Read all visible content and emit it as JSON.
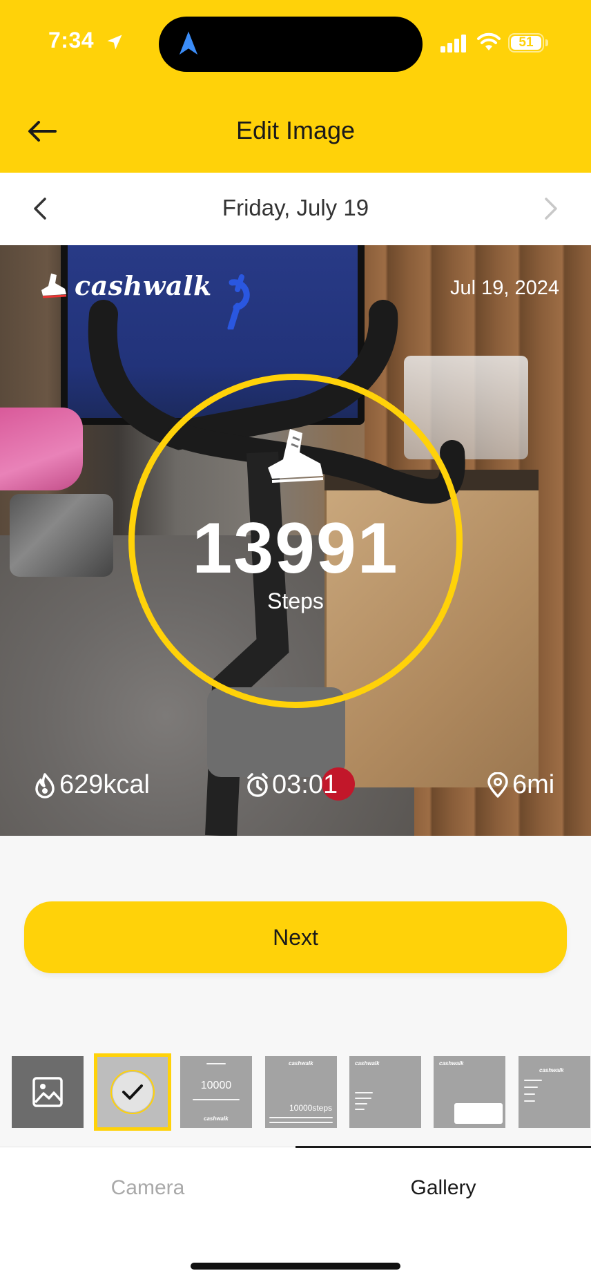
{
  "status_bar": {
    "time": "7:34",
    "battery": "51",
    "icons": [
      "location-arrow-icon",
      "navigation-icon",
      "signal-icon",
      "wifi-icon",
      "battery-icon"
    ]
  },
  "header": {
    "title": "Edit Image",
    "back_icon": "arrow-left-icon",
    "background_color": "#ffd209"
  },
  "date_nav": {
    "label": "Friday, July 19",
    "prev_icon": "chevron-left-icon",
    "next_icon": "chevron-right-icon"
  },
  "photo_overlay": {
    "brand": "cashwalk",
    "date": "Jul 19, 2024",
    "steps_value": "13991",
    "steps_label": "Steps",
    "stats": {
      "calories": "629kcal",
      "duration": "03:01",
      "distance": "6mi"
    },
    "ring_color": "#ffd209"
  },
  "actions": {
    "next_label": "Next"
  },
  "templates": {
    "gallery_icon": "image-icon",
    "selected_check_icon": "checkmark-icon",
    "t3_value": "10000",
    "t4_value": "10000steps",
    "t3_brand": "cashwalk",
    "t4_brand": "cashwalk",
    "t5_brand": "cashwalk",
    "t6_brand": "cashwalk",
    "t7_brand": "cashwalk"
  },
  "tabs": [
    {
      "label": "Camera",
      "active": false
    },
    {
      "label": "Gallery",
      "active": true
    }
  ]
}
